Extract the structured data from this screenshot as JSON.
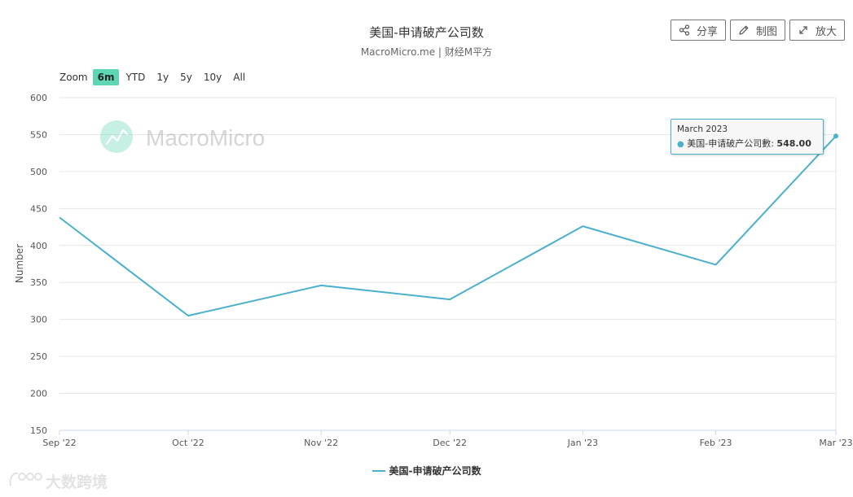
{
  "header": {
    "title": "美国-申请破产公司数",
    "subtitle": "MacroMicro.me | 财经M平方"
  },
  "toolbar": {
    "share_label": "分享",
    "edit_label": "制图",
    "zoom_label": "放大"
  },
  "range_selector": {
    "label": "Zoom",
    "options": [
      "6m",
      "YTD",
      "1y",
      "5y",
      "10y",
      "All"
    ],
    "active": "6m"
  },
  "watermark": {
    "text": "MacroMicro"
  },
  "tooltip": {
    "date": "March 2023",
    "series": "美国-申请破产公司數:",
    "value": "548.00"
  },
  "corner_watermark": {
    "text": "大数跨境"
  },
  "colors": {
    "line": "#4ab0cc",
    "active_range": "#5ed6b5",
    "watermark": "#5ed6b5"
  },
  "chart_data": {
    "type": "line",
    "title": "美国-申请破产公司数",
    "subtitle": "MacroMicro.me | 财经M平方",
    "xlabel": "",
    "ylabel": "Number",
    "categories": [
      "Sep '22",
      "Oct '22",
      "Nov '22",
      "Dec '22",
      "Jan '23",
      "Feb '23",
      "Mar '23"
    ],
    "x_positions": [
      0,
      30,
      61,
      91,
      122,
      153,
      181
    ],
    "series": [
      {
        "name": "美国-申请破产公司數",
        "values": [
          438,
          305,
          346,
          327,
          426,
          374,
          548
        ]
      }
    ],
    "legend_label": "美国-申请破产公司数",
    "yticks": [
      150,
      200,
      250,
      300,
      350,
      400,
      450,
      500,
      550,
      600
    ],
    "ylim": [
      150,
      600
    ],
    "xlim": [
      0,
      181
    ],
    "grid": true,
    "legend_position": "bottom-center"
  }
}
